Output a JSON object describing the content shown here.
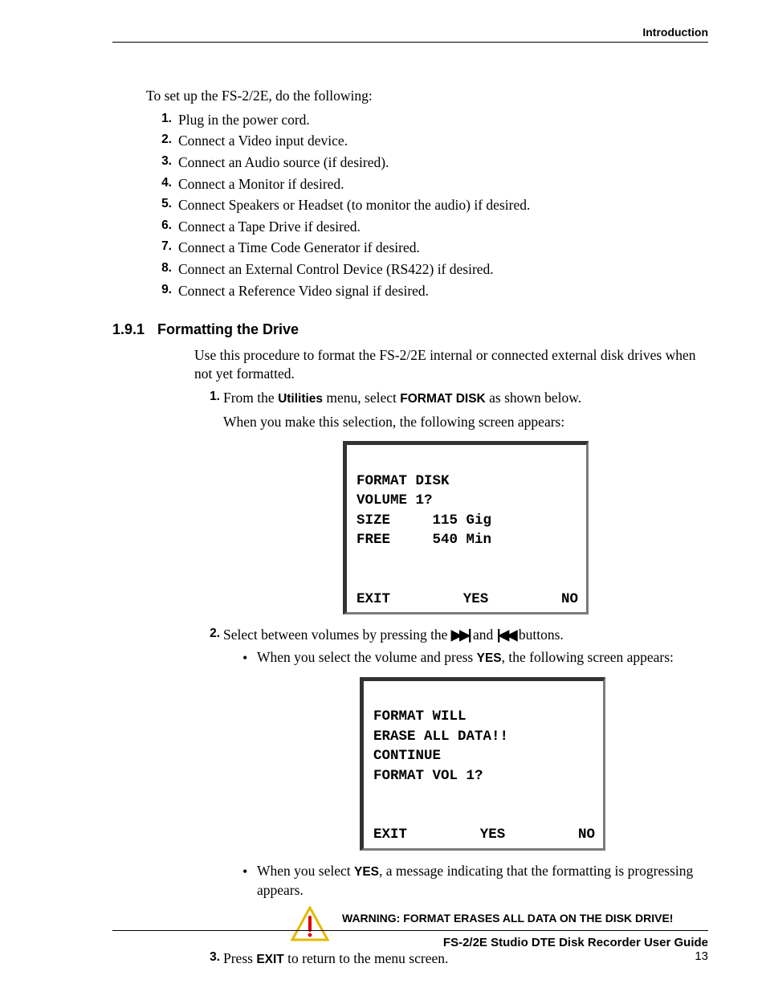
{
  "header": {
    "section": "Introduction"
  },
  "intro": "To set up the FS-2/2E, do the following:",
  "setup_steps": [
    "Plug in the power cord.",
    "Connect a Video input device.",
    "Connect an Audio source (if desired).",
    "Connect a Monitor if desired.",
    "Connect Speakers or Headset (to monitor the audio) if desired.",
    "Connect a Tape Drive if desired.",
    "Connect a Time Code Generator if desired.",
    "Connect an External Control Device (RS422) if desired.",
    "Connect a Reference Video signal if desired."
  ],
  "subsection": {
    "number": "1.9.1",
    "title": "Formatting the Drive"
  },
  "format_intro": "Use this procedure to format the FS-2/2E internal or connected external disk drives when not yet formatted.",
  "step1": {
    "pre": "From the ",
    "menu": "Utilities",
    "mid": " menu, select ",
    "cmd": "FORMAT DISK",
    "post": " as shown below.",
    "line2": "When you make this selection, the following screen appears:"
  },
  "lcd1": {
    "l1": "FORMAT DISK",
    "l2": "VOLUME 1?",
    "l3a": "SIZE",
    "l3b": "115 Gig",
    "l4a": "FREE",
    "l4b": "540 Min",
    "b1": "EXIT",
    "b2": "YES",
    "b3": "NO"
  },
  "step2": {
    "pre": "Select between volumes by pressing the ",
    "glyph1": "▶▶|",
    "mid": " and ",
    "glyph2": "|◀◀",
    "post": " buttons.",
    "bullet1_pre": "When you select the volume and press ",
    "bullet1_bold": "YES",
    "bullet1_post": ", the following screen appears:",
    "bullet2_pre": "When you select ",
    "bullet2_bold": "YES",
    "bullet2_post": ", a message indicating that the formatting is progressing appears."
  },
  "lcd2": {
    "l1": "FORMAT WILL",
    "l2": "ERASE ALL DATA!!",
    "l3": "CONTINUE",
    "l4": "FORMAT VOL 1?",
    "b1": "EXIT",
    "b2": "YES",
    "b3": "NO"
  },
  "warning": "WARNING: FORMAT ERASES ALL DATA ON THE DISK DRIVE!",
  "step3": {
    "pre": "Press ",
    "bold": "EXIT",
    "post": " to return to the menu screen."
  },
  "footer": {
    "title": "FS-2/2E Studio DTE Disk Recorder User Guide",
    "page": "13"
  }
}
